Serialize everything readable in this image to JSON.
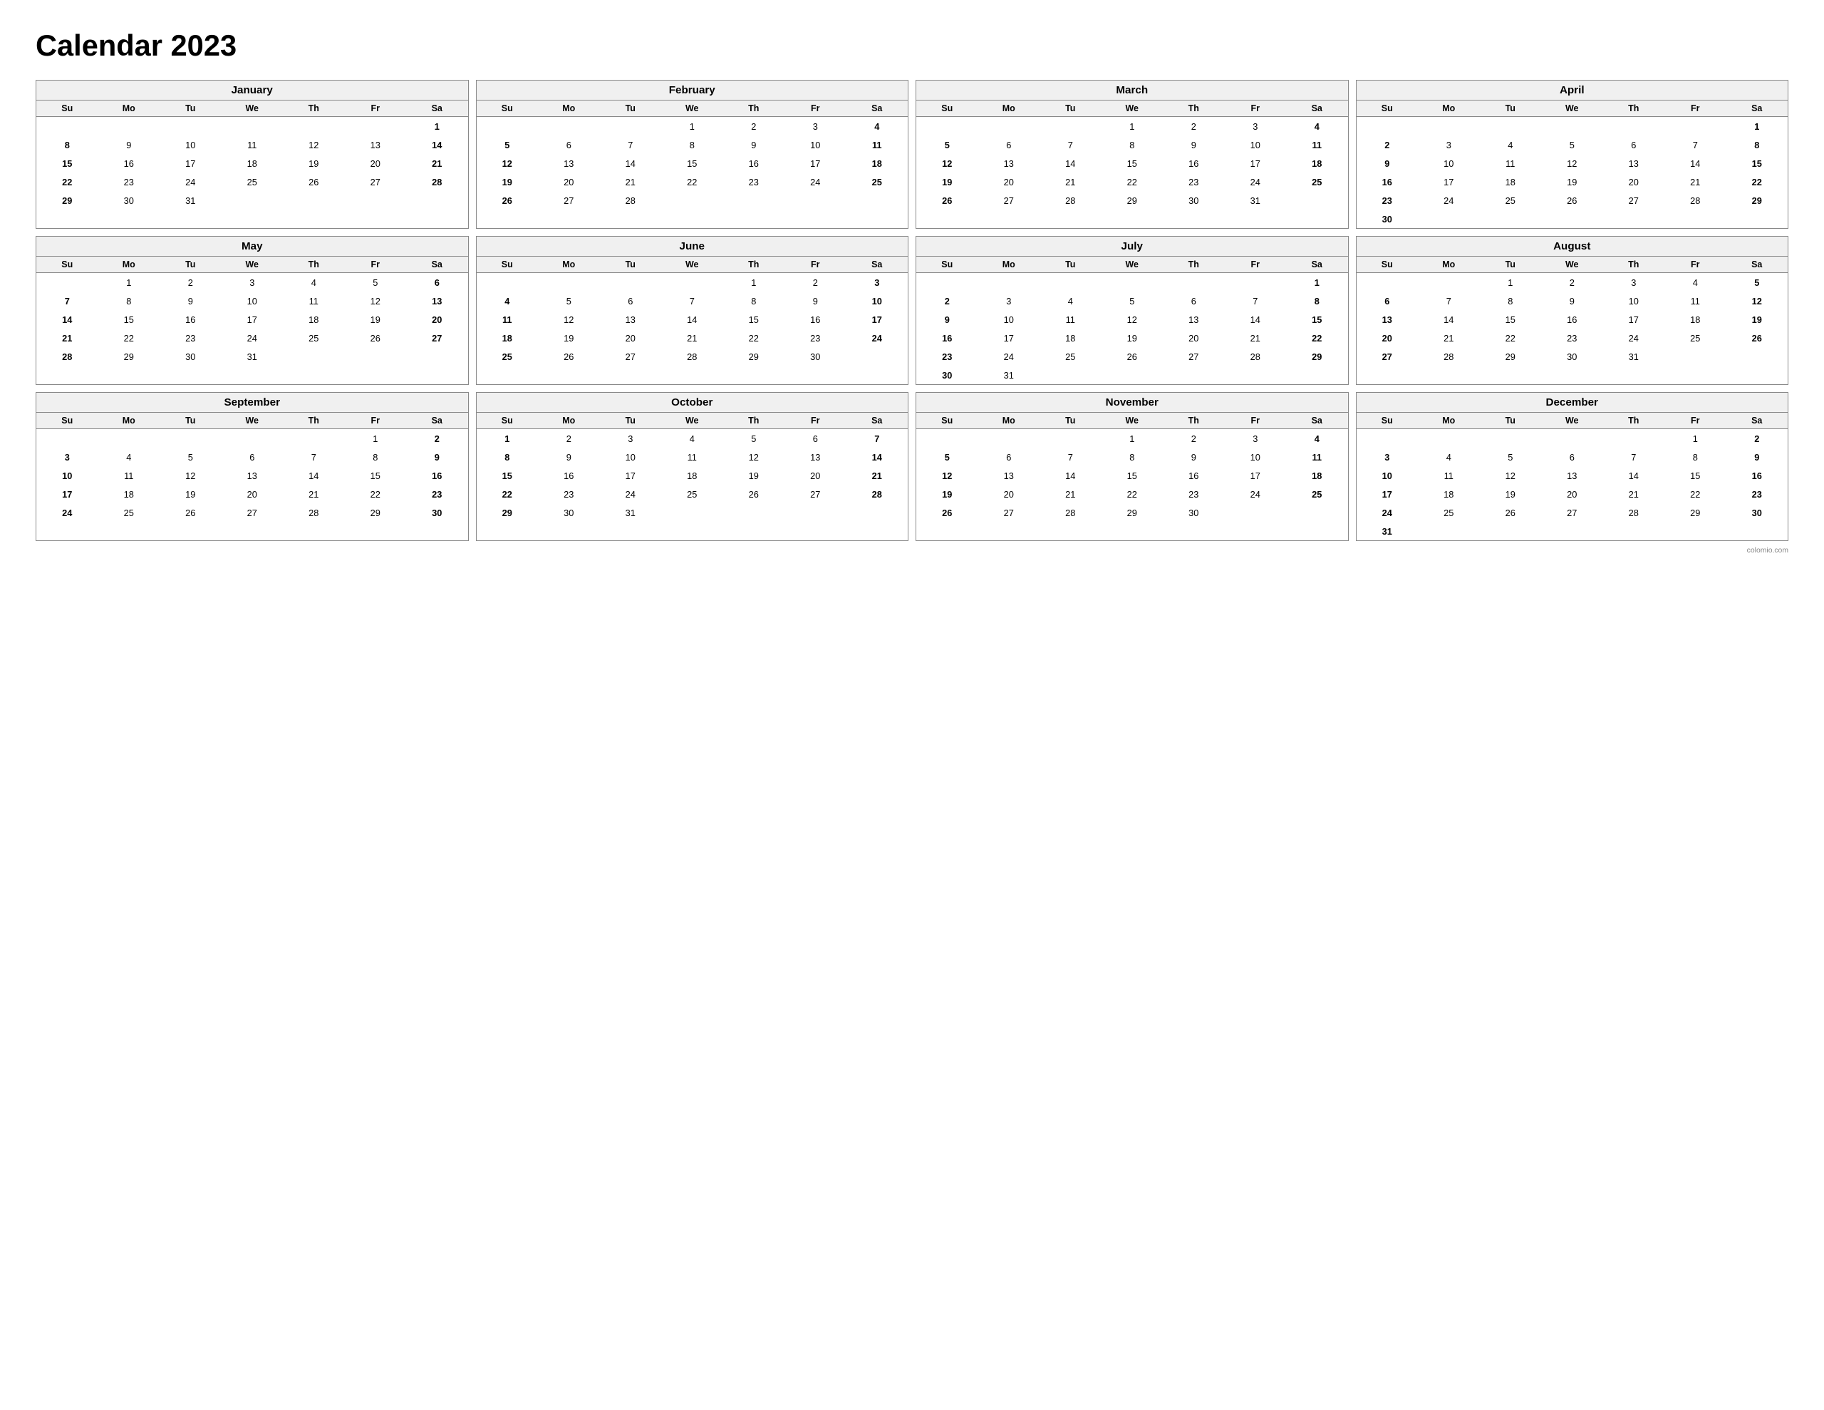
{
  "title": "Calendar 2023",
  "footer": "colomio.com",
  "months": [
    {
      "name": "January",
      "startDay": 0,
      "days": 31,
      "weeks": [
        [
          null,
          null,
          null,
          null,
          null,
          null,
          "1"
        ],
        [
          "8",
          "9",
          "10",
          "11",
          "12",
          "13",
          "14"
        ],
        [
          "15",
          "16",
          "17",
          "18",
          "19",
          "20",
          "21"
        ],
        [
          "22",
          "23",
          "24",
          "25",
          "26",
          "27",
          "28"
        ],
        [
          "29",
          "30",
          "31",
          null,
          null,
          null,
          null
        ]
      ],
      "row1": [
        "",
        "",
        "",
        "",
        "",
        "",
        "1"
      ],
      "row2": [
        "8",
        "9",
        "10",
        "11",
        "12",
        "13",
        "14"
      ],
      "row3": [
        "15",
        "16",
        "17",
        "18",
        "19",
        "20",
        "21"
      ],
      "row4": [
        "22",
        "23",
        "24",
        "25",
        "26",
        "27",
        "28"
      ],
      "row5": [
        "29",
        "30",
        "31",
        "",
        "",
        "",
        ""
      ]
    },
    {
      "name": "February",
      "row1": [
        "",
        "",
        "",
        "1",
        "2",
        "3",
        "4"
      ],
      "row2": [
        "5",
        "6",
        "7",
        "8",
        "9",
        "10",
        "11"
      ],
      "row3": [
        "12",
        "13",
        "14",
        "15",
        "16",
        "17",
        "18"
      ],
      "row4": [
        "19",
        "20",
        "21",
        "22",
        "23",
        "24",
        "25"
      ],
      "row5": [
        "26",
        "27",
        "28",
        "",
        "",
        "",
        ""
      ]
    },
    {
      "name": "March",
      "row1": [
        "",
        "",
        "",
        "1",
        "2",
        "3",
        "4"
      ],
      "row2": [
        "5",
        "6",
        "7",
        "8",
        "9",
        "10",
        "11"
      ],
      "row3": [
        "12",
        "13",
        "14",
        "15",
        "16",
        "17",
        "18"
      ],
      "row4": [
        "19",
        "20",
        "21",
        "22",
        "23",
        "24",
        "25"
      ],
      "row5": [
        "26",
        "27",
        "28",
        "29",
        "30",
        "31",
        ""
      ]
    },
    {
      "name": "April",
      "row1": [
        "",
        "",
        "",
        "",
        "",
        "",
        "1"
      ],
      "row2": [
        "2",
        "3",
        "4",
        "5",
        "6",
        "7",
        "8"
      ],
      "row3": [
        "9",
        "10",
        "11",
        "12",
        "13",
        "14",
        "15"
      ],
      "row4": [
        "16",
        "17",
        "18",
        "19",
        "20",
        "21",
        "22"
      ],
      "row5": [
        "23",
        "24",
        "25",
        "26",
        "27",
        "28",
        "29"
      ],
      "row6": [
        "30",
        "",
        "",
        "",
        "",
        "",
        ""
      ]
    },
    {
      "name": "May",
      "row1": [
        "",
        "1",
        "2",
        "3",
        "4",
        "5",
        "6"
      ],
      "row2": [
        "7",
        "8",
        "9",
        "10",
        "11",
        "12",
        "13"
      ],
      "row3": [
        "14",
        "15",
        "16",
        "17",
        "18",
        "19",
        "20"
      ],
      "row4": [
        "21",
        "22",
        "23",
        "24",
        "25",
        "26",
        "27"
      ],
      "row5": [
        "28",
        "29",
        "30",
        "31",
        "",
        "",
        ""
      ]
    },
    {
      "name": "June",
      "row1": [
        "",
        "",
        "",
        "",
        "1",
        "2",
        "3"
      ],
      "row2": [
        "4",
        "5",
        "6",
        "7",
        "8",
        "9",
        "10"
      ],
      "row3": [
        "11",
        "12",
        "13",
        "14",
        "15",
        "16",
        "17"
      ],
      "row4": [
        "18",
        "19",
        "20",
        "21",
        "22",
        "23",
        "24"
      ],
      "row5": [
        "25",
        "26",
        "27",
        "28",
        "29",
        "30",
        ""
      ]
    },
    {
      "name": "July",
      "row1": [
        "",
        "",
        "",
        "",
        "",
        "",
        "1"
      ],
      "row2": [
        "2",
        "3",
        "4",
        "5",
        "6",
        "7",
        "8"
      ],
      "row3": [
        "9",
        "10",
        "11",
        "12",
        "13",
        "14",
        "15"
      ],
      "row4": [
        "16",
        "17",
        "18",
        "19",
        "20",
        "21",
        "22"
      ],
      "row5": [
        "23",
        "24",
        "25",
        "26",
        "27",
        "28",
        "29"
      ],
      "row6": [
        "30",
        "31",
        "",
        "",
        "",
        "",
        ""
      ]
    },
    {
      "name": "August",
      "row1": [
        "",
        "",
        "1",
        "2",
        "3",
        "4",
        "5"
      ],
      "row2": [
        "6",
        "7",
        "8",
        "9",
        "10",
        "11",
        "12"
      ],
      "row3": [
        "13",
        "14",
        "15",
        "16",
        "17",
        "18",
        "19"
      ],
      "row4": [
        "20",
        "21",
        "22",
        "23",
        "24",
        "25",
        "26"
      ],
      "row5": [
        "27",
        "28",
        "29",
        "30",
        "31",
        "",
        ""
      ]
    },
    {
      "name": "September",
      "row1": [
        "",
        "",
        "",
        "",
        "",
        "1",
        "2"
      ],
      "row2": [
        "3",
        "4",
        "5",
        "6",
        "7",
        "8",
        "9"
      ],
      "row3": [
        "10",
        "11",
        "12",
        "13",
        "14",
        "15",
        "16"
      ],
      "row4": [
        "17",
        "18",
        "19",
        "20",
        "21",
        "22",
        "23"
      ],
      "row5": [
        "24",
        "25",
        "26",
        "27",
        "28",
        "29",
        "30"
      ]
    },
    {
      "name": "October",
      "row1": [
        "1",
        "2",
        "3",
        "4",
        "5",
        "6",
        "7"
      ],
      "row2": [
        "8",
        "9",
        "10",
        "11",
        "12",
        "13",
        "14"
      ],
      "row3": [
        "15",
        "16",
        "17",
        "18",
        "19",
        "20",
        "21"
      ],
      "row4": [
        "22",
        "23",
        "24",
        "25",
        "26",
        "27",
        "28"
      ],
      "row5": [
        "29",
        "30",
        "31",
        "",
        "",
        "",
        ""
      ]
    },
    {
      "name": "November",
      "row1": [
        "",
        "",
        "",
        "1",
        "2",
        "3",
        "4"
      ],
      "row2": [
        "5",
        "6",
        "7",
        "8",
        "9",
        "10",
        "11"
      ],
      "row3": [
        "12",
        "13",
        "14",
        "15",
        "16",
        "17",
        "18"
      ],
      "row4": [
        "19",
        "20",
        "21",
        "22",
        "23",
        "24",
        "25"
      ],
      "row5": [
        "26",
        "27",
        "28",
        "29",
        "30",
        "",
        ""
      ]
    },
    {
      "name": "December",
      "row1": [
        "",
        "",
        "",
        "",
        "",
        "1",
        "2"
      ],
      "row2": [
        "3",
        "4",
        "5",
        "6",
        "7",
        "8",
        "9"
      ],
      "row3": [
        "10",
        "11",
        "12",
        "13",
        "14",
        "15",
        "16"
      ],
      "row4": [
        "17",
        "18",
        "19",
        "20",
        "21",
        "22",
        "23"
      ],
      "row5": [
        "24",
        "25",
        "26",
        "27",
        "28",
        "29",
        "30"
      ],
      "row6": [
        "31",
        "",
        "",
        "",
        "",
        "",
        ""
      ]
    }
  ],
  "dayHeaders": [
    "Su",
    "Mo",
    "Tu",
    "We",
    "Th",
    "Fr",
    "Sa"
  ]
}
